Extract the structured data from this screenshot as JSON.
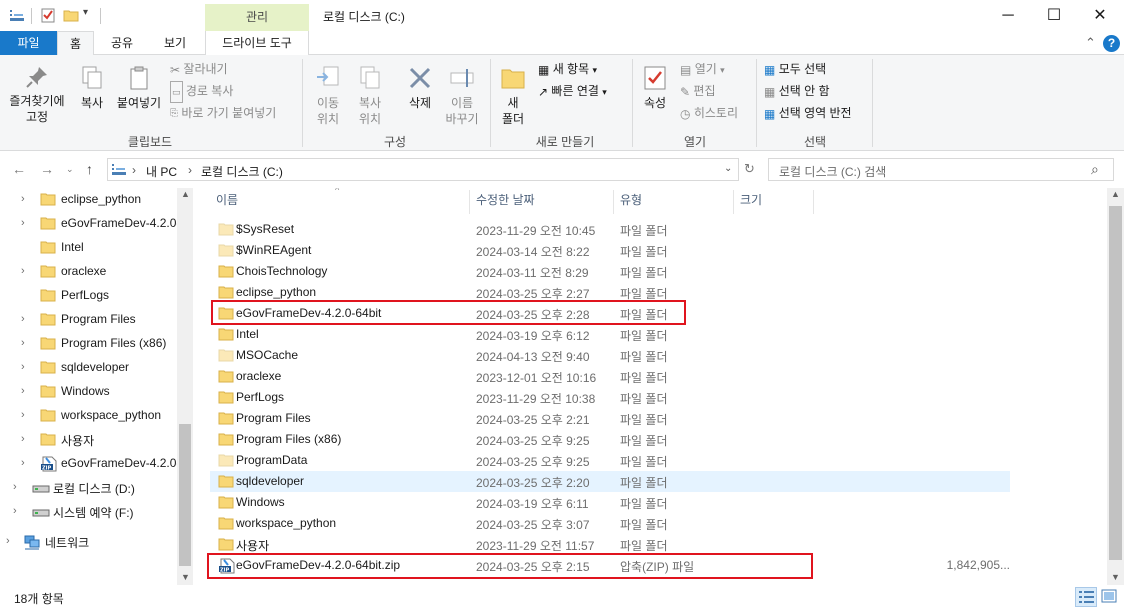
{
  "title_bar": {
    "manage_tab": "관리",
    "window_title": "로컬 디스크 (C:)",
    "minimize": "─",
    "maximize": "☐",
    "close": "✕"
  },
  "ribbon_tabs": {
    "file": "파일",
    "home": "홈",
    "share": "공유",
    "view": "보기",
    "drive_tools": "드라이브 도구"
  },
  "ribbon": {
    "clipboard": {
      "pin": "즐겨찾기에\n고정",
      "copy": "복사",
      "paste": "붙여넣기",
      "cut": "잘라내기",
      "copy_path": "경로 복사",
      "paste_shortcut": "바로 가기 붙여넣기",
      "label": "클립보드"
    },
    "organize": {
      "move_to": "이동\n위치",
      "copy_to": "복사\n위치",
      "delete": "삭제",
      "rename": "이름\n바꾸기",
      "label": "구성"
    },
    "new": {
      "new_folder": "새\n폴더",
      "new_item": "새 항목",
      "easy_access": "빠른 연결",
      "label": "새로 만들기"
    },
    "open": {
      "properties": "속성",
      "open": "열기",
      "edit": "편집",
      "history": "히스토리",
      "label": "열기"
    },
    "select": {
      "select_all": "모두 선택",
      "select_none": "선택 안 함",
      "invert": "선택 영역 반전",
      "label": "선택"
    }
  },
  "address": {
    "crumbs": [
      "내 PC",
      "로컬 디스크 (C:)"
    ],
    "search_placeholder": "로컬 디스크 (C:) 검색"
  },
  "nav_pane": {
    "items": [
      {
        "label": "eclipse_python",
        "icon": "folder-icon",
        "chevron": "›"
      },
      {
        "label": "eGovFrameDev-4.2.0-",
        "icon": "folder-icon",
        "chevron": "›"
      },
      {
        "label": "Intel",
        "icon": "folder-icon",
        "chevron": ""
      },
      {
        "label": "oraclexe",
        "icon": "folder-icon",
        "chevron": "›"
      },
      {
        "label": "PerfLogs",
        "icon": "folder-icon",
        "chevron": ""
      },
      {
        "label": "Program Files",
        "icon": "folder-icon",
        "chevron": "›"
      },
      {
        "label": "Program Files (x86)",
        "icon": "folder-icon",
        "chevron": "›"
      },
      {
        "label": "sqldeveloper",
        "icon": "folder-icon",
        "chevron": "›"
      },
      {
        "label": "Windows",
        "icon": "folder-icon",
        "chevron": "›"
      },
      {
        "label": "workspace_python",
        "icon": "folder-icon",
        "chevron": "›"
      },
      {
        "label": "사용자",
        "icon": "folder-icon",
        "chevron": "›"
      },
      {
        "label": "eGovFrameDev-4.2.0-",
        "icon": "zip-icon",
        "chevron": "›"
      }
    ],
    "drives": [
      {
        "label": "로컬 디스크 (D:)",
        "icon": "drive-icon",
        "chevron": "›"
      },
      {
        "label": "시스템 예약 (F:)",
        "icon": "drive-icon",
        "chevron": "›"
      }
    ],
    "network": {
      "label": "네트워크",
      "icon": "network-icon",
      "chevron": "›"
    }
  },
  "file_list": {
    "columns": {
      "name": "이름",
      "date": "수정한 날짜",
      "type": "유형",
      "size": "크기"
    },
    "rows": [
      {
        "name": "$SysReset",
        "date": "2023-11-29 오전 10:45",
        "type": "파일 폴더",
        "size": "",
        "icon": "folder-icon",
        "faded": true
      },
      {
        "name": "$WinREAgent",
        "date": "2024-03-14 오전 8:22",
        "type": "파일 폴더",
        "size": "",
        "icon": "folder-icon",
        "faded": true
      },
      {
        "name": "ChoisTechnology",
        "date": "2024-03-11 오전 8:29",
        "type": "파일 폴더",
        "size": "",
        "icon": "folder-icon",
        "faded": false
      },
      {
        "name": "eclipse_python",
        "date": "2024-03-25 오후 2:27",
        "type": "파일 폴더",
        "size": "",
        "icon": "folder-icon",
        "faded": false
      },
      {
        "name": "eGovFrameDev-4.2.0-64bit",
        "date": "2024-03-25 오후 2:28",
        "type": "파일 폴더",
        "size": "",
        "icon": "folder-icon",
        "faded": false
      },
      {
        "name": "Intel",
        "date": "2024-03-19 오후 6:12",
        "type": "파일 폴더",
        "size": "",
        "icon": "folder-icon",
        "faded": false
      },
      {
        "name": "MSOCache",
        "date": "2024-04-13 오전 9:40",
        "type": "파일 폴더",
        "size": "",
        "icon": "folder-icon",
        "faded": true
      },
      {
        "name": "oraclexe",
        "date": "2023-12-01 오전 10:16",
        "type": "파일 폴더",
        "size": "",
        "icon": "folder-icon",
        "faded": false
      },
      {
        "name": "PerfLogs",
        "date": "2023-11-29 오전 10:38",
        "type": "파일 폴더",
        "size": "",
        "icon": "folder-icon",
        "faded": false
      },
      {
        "name": "Program Files",
        "date": "2024-03-25 오후 2:21",
        "type": "파일 폴더",
        "size": "",
        "icon": "folder-icon",
        "faded": false
      },
      {
        "name": "Program Files (x86)",
        "date": "2024-03-25 오후 9:25",
        "type": "파일 폴더",
        "size": "",
        "icon": "folder-icon",
        "faded": false
      },
      {
        "name": "ProgramData",
        "date": "2024-03-25 오후 9:25",
        "type": "파일 폴더",
        "size": "",
        "icon": "folder-icon",
        "faded": true
      },
      {
        "name": "sqldeveloper",
        "date": "2024-03-25 오후 2:20",
        "type": "파일 폴더",
        "size": "",
        "icon": "folder-icon",
        "faded": false
      },
      {
        "name": "Windows",
        "date": "2024-03-19 오후 6:11",
        "type": "파일 폴더",
        "size": "",
        "icon": "folder-icon",
        "faded": false
      },
      {
        "name": "workspace_python",
        "date": "2024-03-25 오후 3:07",
        "type": "파일 폴더",
        "size": "",
        "icon": "folder-icon",
        "faded": false
      },
      {
        "name": "사용자",
        "date": "2023-11-29 오전 11:57",
        "type": "파일 폴더",
        "size": "",
        "icon": "folder-icon",
        "faded": false
      },
      {
        "name": "eGovFrameDev-4.2.0-64bit.zip",
        "date": "2024-03-25 오후 2:15",
        "type": "압축(ZIP) 파일",
        "size": "1,842,905...",
        "icon": "zip-icon",
        "faded": false
      }
    ]
  },
  "status_bar": {
    "count": "18개 항목"
  },
  "colors": {
    "accent": "#1979ca",
    "highlight": "#e0141e",
    "folder": "#f8d775",
    "selected_row": "#e5f3ff"
  }
}
